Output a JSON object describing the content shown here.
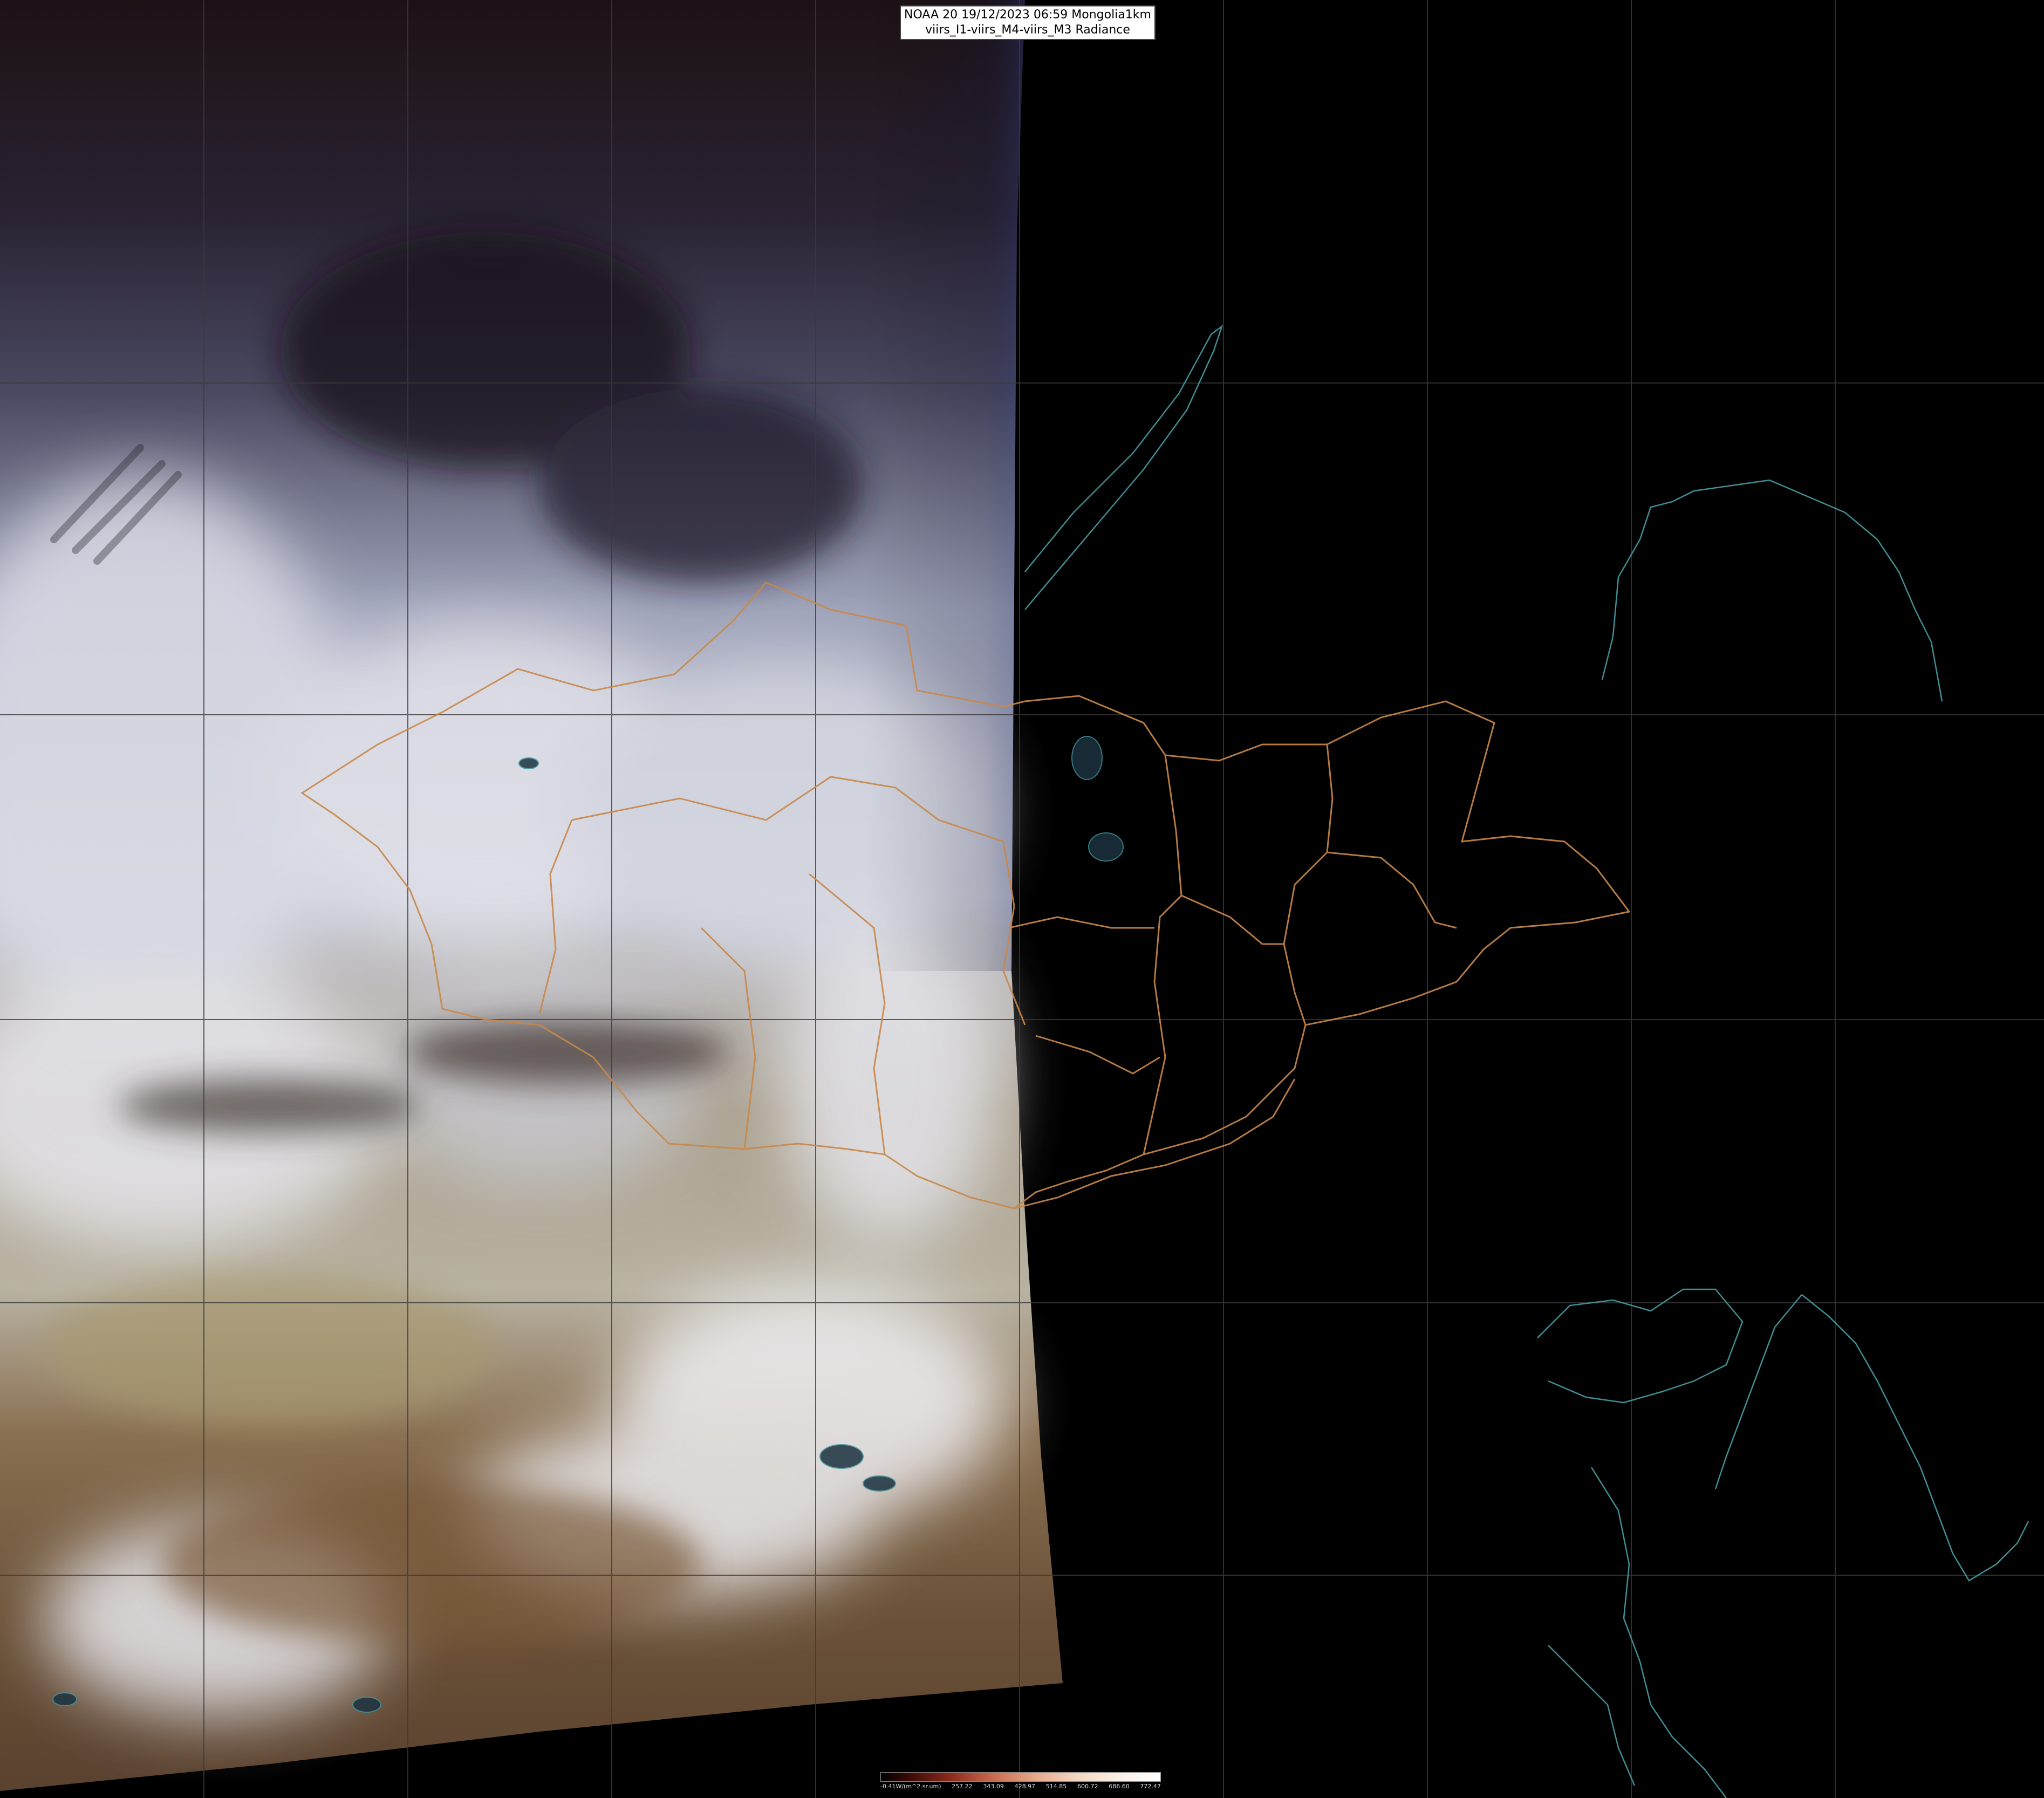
{
  "title": {
    "line1": "NOAA 20 19/12/2023 06:59 Mongolia1km",
    "line2": "viirs_I1-viirs_M4-viirs_M3 Radiance"
  },
  "legend": {
    "ticks": [
      "-0.41W/(m^2.sr.um)",
      "257.22",
      "343.09",
      "428.97",
      "514.85",
      "600.72",
      "686.60",
      "772.47"
    ]
  },
  "colors": {
    "background": "#000000",
    "border_lines": "#c8884a",
    "coast_lines": "#3f8f96",
    "graticule": "#3a3a3a"
  }
}
